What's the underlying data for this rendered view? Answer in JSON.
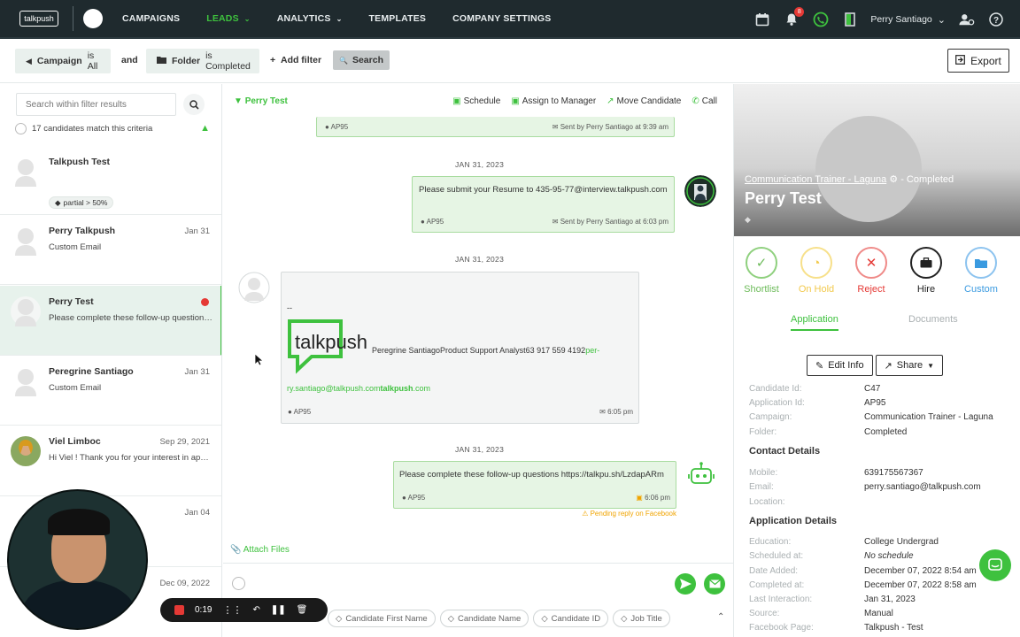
{
  "nav": {
    "logo": "talkpush",
    "links": [
      "CAMPAIGNS",
      "LEADS",
      "ANALYTICS",
      "TEMPLATES",
      "COMPANY SETTINGS"
    ],
    "notif_count": "8",
    "user": "Perry Santiago"
  },
  "filters": {
    "campaign_key": "Campaign",
    "campaign_val": "is All",
    "and": "and",
    "folder_key": "Folder",
    "folder_val": "is Completed",
    "add_filter": "Add filter",
    "search": "Search",
    "export": "Export"
  },
  "left": {
    "search_placeholder": "Search within filter results",
    "match": "17 candidates match this criteria",
    "candidates": [
      {
        "name": "Talkpush Test",
        "date": "",
        "sub": "",
        "tag": "partial > 50%"
      },
      {
        "name": "Perry Talkpush",
        "date": "Jan 31",
        "sub": "Custom Email"
      },
      {
        "name": "Perry Test",
        "date": "",
        "sub": "Please complete these follow-up questions ..."
      },
      {
        "name": "Peregrine Santiago",
        "date": "Jan 31",
        "sub": "Custom Email"
      },
      {
        "name": "Viel Limboc",
        "date": "Sep 29, 2021",
        "sub": "Hi Viel ! Thank you for your interest in applyi..."
      },
      {
        "name": "",
        "date": "Jan 04",
        "sub": ""
      },
      {
        "name": "",
        "date": "Dec 09, 2022",
        "sub": ""
      }
    ],
    "recording_time": "0:19"
  },
  "chat": {
    "candidate": "Perry Test",
    "actions": [
      "Schedule",
      "Assign to Manager",
      "Move Candidate",
      "Call"
    ],
    "top_bubble": {
      "code": "AP95",
      "sent": "Sent by Perry Santiago at 9:39 am"
    },
    "date1": "JAN 31, 2023",
    "msg1": {
      "text": "Please submit your Resume to 435-95-77@interview.talkpush.com",
      "code": "AP95",
      "sent": "Sent by Perry Santiago at 6:03 pm"
    },
    "date2": "JAN 31, 2023",
    "email": {
      "dash": "--",
      "logo": "talkpush",
      "line1": "Peregrine SantiagoProduct Support Analyst63 917 559 4192",
      "line1_link": "per-",
      "line2_a": "ry.santiago@talkpush.com",
      "line2_b": "talkpush",
      "line2_c": ".com",
      "code": "AP95",
      "time": "6:05 pm"
    },
    "date3": "JAN 31, 2023",
    "msg2": {
      "text": "Please complete these follow-up questions https://talkpu.sh/LzdapARm",
      "code": "AP95",
      "time": "6:06 pm"
    },
    "pending": "Pending reply on Facebook",
    "attach": "Attach Files",
    "tokens": [
      "Candidate First Name",
      "Candidate Name",
      "Candidate ID",
      "Job Title"
    ]
  },
  "right": {
    "job": "Communication Trainer - Laguna",
    "status": "- Completed",
    "name": "Perry Test",
    "actions": [
      {
        "label": "Shortlist",
        "color": "#6dbb5a",
        "icon": "check-icon"
      },
      {
        "label": "On Hold",
        "color": "#f2c94c",
        "icon": "clock-icon"
      },
      {
        "label": "Reject",
        "color": "#e53935",
        "icon": "x-icon"
      },
      {
        "label": "Hire",
        "color": "#222222",
        "icon": "briefcase-icon"
      },
      {
        "label": "Custom",
        "color": "#3a9ae0",
        "icon": "folder-icon"
      }
    ],
    "tab_app": "Application",
    "tab_docs": "Documents",
    "edit": "Edit Info",
    "share": "Share",
    "candidate_id_k": "Candidate Id:",
    "candidate_id_v": "C47",
    "application_id_k": "Application Id:",
    "application_id_v": "AP95",
    "campaign_k": "Campaign:",
    "campaign_v": "Communication Trainer - Laguna",
    "folder_k": "Folder:",
    "folder_v": "Completed",
    "contact": "Contact Details",
    "mobile_k": "Mobile:",
    "mobile_v": "639175567367",
    "email_k": "Email:",
    "email_v": "perry.santiago@talkpush.com",
    "location_k": "Location:",
    "appdetails": "Application Details",
    "education_k": "Education:",
    "education_v": "College Undergrad",
    "scheduled_k": "Scheduled at:",
    "scheduled_v": "No schedule",
    "added_k": "Date Added:",
    "added_v": "December 07, 2022 8:54 am",
    "completed_k": "Completed at:",
    "completed_v": "December 07, 2022 8:58 am",
    "last_k": "Last Interaction:",
    "last_v": "Jan 31, 2023",
    "source_k": "Source:",
    "source_v": "Manual",
    "fb_k": "Facebook Page:",
    "fb_v": "Talkpush - Test"
  }
}
